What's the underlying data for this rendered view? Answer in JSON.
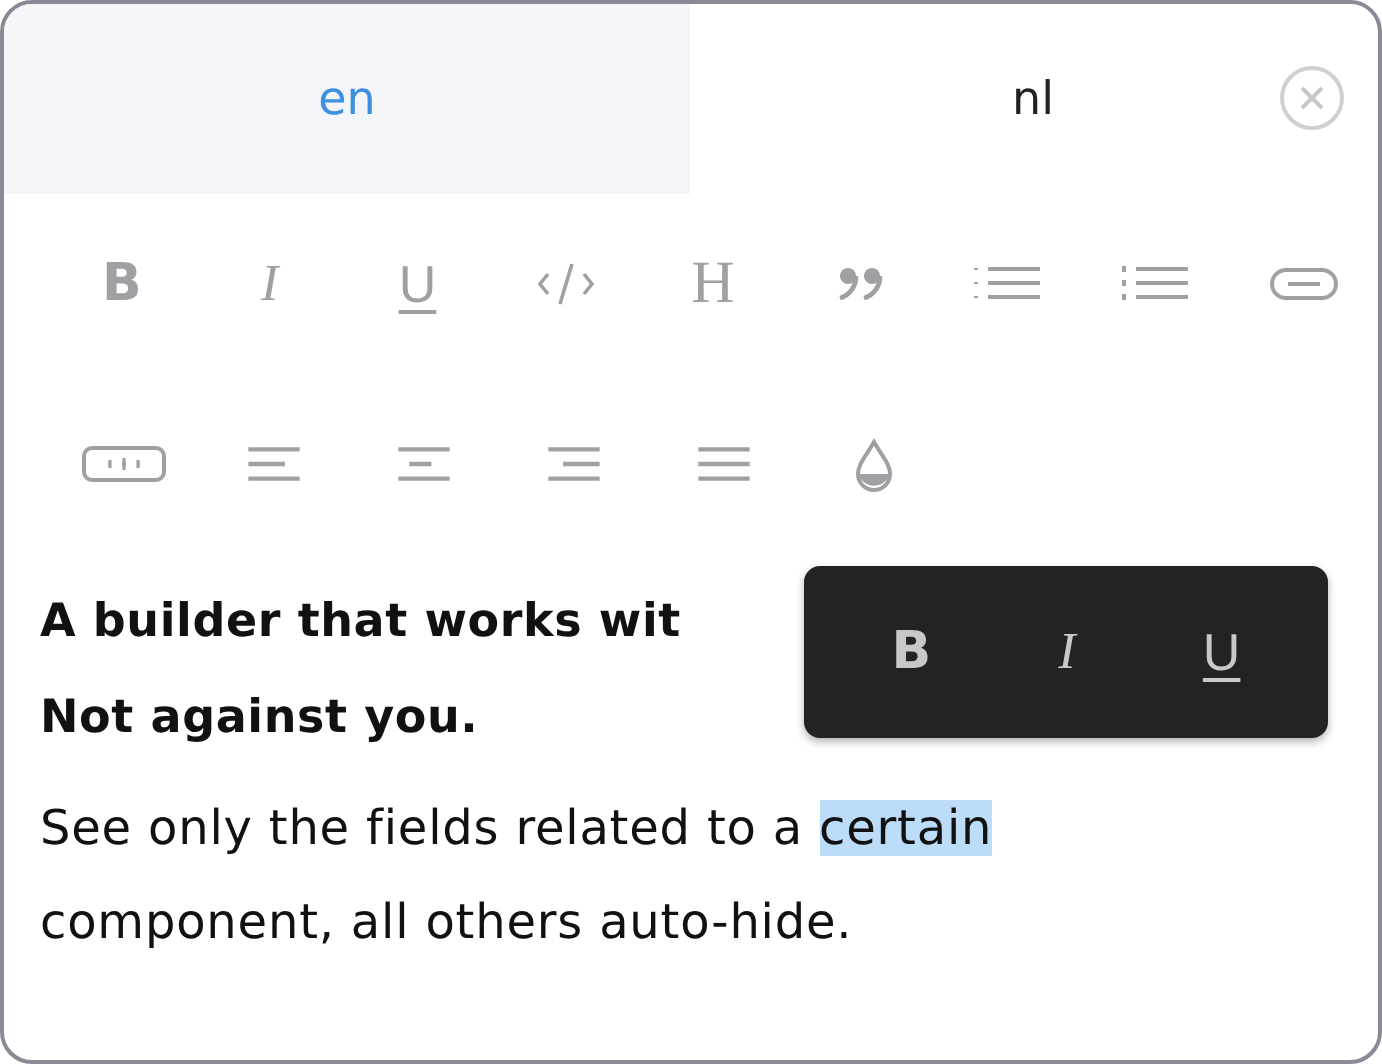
{
  "tabs": [
    {
      "label": "en",
      "selected": true
    },
    {
      "label": "nl",
      "selected": false
    }
  ],
  "toolbar_rows": [
    [
      {
        "kind": "bold",
        "label": "B"
      },
      {
        "kind": "italic",
        "label": "I"
      },
      {
        "kind": "underline",
        "label": "U"
      },
      {
        "kind": "code"
      },
      {
        "kind": "heading",
        "label": "H"
      },
      {
        "kind": "quote"
      },
      {
        "kind": "bullets"
      },
      {
        "kind": "numbers"
      },
      {
        "kind": "link"
      }
    ],
    [
      {
        "kind": "button"
      },
      {
        "kind": "align-left"
      },
      {
        "kind": "align-center"
      },
      {
        "kind": "align-right"
      },
      {
        "kind": "justify"
      },
      {
        "kind": "color"
      }
    ]
  ],
  "heading_lines": [
    "A builder that works wit",
    "Not against you."
  ],
  "paragraph": [
    {
      "text": "See only the fields related to a ",
      "selected": false
    },
    {
      "text": "certain",
      "selected": true
    },
    {
      "text": " component, all others auto-hide.",
      "selected": false
    }
  ],
  "popup_buttons": [
    {
      "kind": "bold",
      "label": "B"
    },
    {
      "kind": "italic",
      "label": "I"
    },
    {
      "kind": "underline",
      "label": "U"
    }
  ]
}
